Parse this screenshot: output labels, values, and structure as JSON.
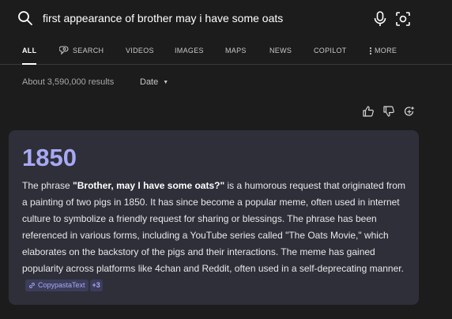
{
  "search": {
    "query": "first appearance of brother may i have some oats"
  },
  "tabs": [
    {
      "label": "ALL",
      "active": true
    },
    {
      "label": "SEARCH",
      "icon": "copilot-search-icon"
    },
    {
      "label": "VIDEOS"
    },
    {
      "label": "IMAGES"
    },
    {
      "label": "MAPS"
    },
    {
      "label": "NEWS"
    },
    {
      "label": "COPILOT"
    },
    {
      "label": "MORE",
      "icon": "kebab-icon"
    }
  ],
  "results": {
    "count": "About 3,590,000 results",
    "date_filter": "Date"
  },
  "answer": {
    "headline": "1850",
    "text_before": "The phrase ",
    "text_bold": "\"Brother, may I have some oats?\"",
    "text_after": " is a humorous request that originated from a painting of two pigs in 1850. It has since become a popular meme, often used in internet culture to symbolize a friendly request for sharing or blessings. The phrase has been referenced in various forms, including a YouTube series called \"The Oats Movie,\" which elaborates on the backstory of the pigs and their interactions. The meme has gained popularity across platforms like 4chan and Reddit, often used in a self-deprecating manner.",
    "source_label": "CopypastaText",
    "more_sources": "+3"
  },
  "colors": {
    "background": "#1c1c1c",
    "card": "#2f2f3a",
    "accent": "#a8a9f4"
  }
}
